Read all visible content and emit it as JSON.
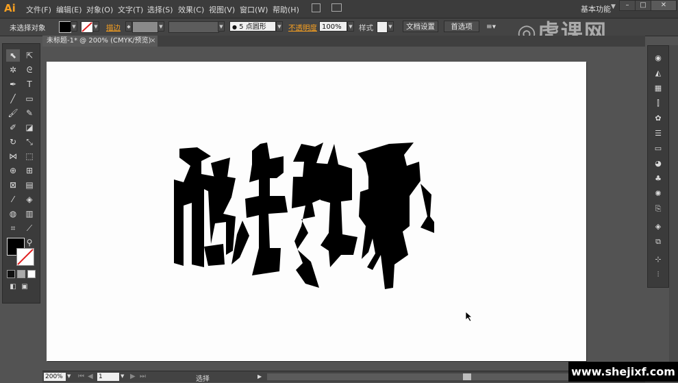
{
  "app": {
    "logo": "Ai"
  },
  "menu": [
    "文件(F)",
    "编辑(E)",
    "对象(O)",
    "文字(T)",
    "选择(S)",
    "效果(C)",
    "视图(V)",
    "窗口(W)",
    "帮助(H)"
  ],
  "workspace": {
    "label": "基本功能",
    "arrow": "▼"
  },
  "window_controls": [
    "–",
    "□",
    "✕"
  ],
  "control_bar": {
    "selection_label": "未选择对象",
    "stroke_label": "描边",
    "brush_value": "5 点圆形",
    "opacity_label": "不透明度",
    "opacity_value": "100%",
    "style_label": "样式",
    "doc_settings": "文档设置",
    "preferences": "首选项"
  },
  "document_tab": {
    "title": "未标题-1* @ 200% (CMYK/预览)",
    "close": "×"
  },
  "status_bar": {
    "zoom": "200%",
    "page": "1",
    "tool": "选择"
  },
  "watermark": {
    "site": "www.shejixf.com",
    "brand": "虎课网"
  },
  "colors": {
    "accent": "#f7a021",
    "stroke_label": "#f7a021",
    "artboard": "#fdfdfd"
  },
  "icons": {
    "tools": [
      "selection-icon",
      "direct-selection-icon",
      "magic-wand-icon",
      "lasso-icon",
      "pen-icon",
      "type-icon",
      "line-icon",
      "rectangle-icon",
      "paintbrush-icon",
      "pencil-icon",
      "blob-brush-icon",
      "eraser-icon",
      "rotate-icon",
      "scale-icon",
      "width-icon",
      "free-transform-icon",
      "shape-builder-icon",
      "perspective-icon",
      "mesh-icon",
      "gradient-icon",
      "eyedropper-icon",
      "blend-icon",
      "symbol-sprayer-icon",
      "column-graph-icon",
      "artboard-icon",
      "slice-icon",
      "hand-icon",
      "zoom-icon"
    ],
    "panels": [
      "color-icon",
      "color-guide-icon",
      "swatches-icon",
      "brushes-icon",
      "symbols-icon",
      "stroke-icon",
      "gradient-panel-icon",
      "transparency-icon",
      "appearance-icon",
      "graphic-styles-icon",
      "layers-icon",
      "artboards-icon",
      "align-icon",
      "transform-icon",
      "pathfinder-icon"
    ]
  }
}
